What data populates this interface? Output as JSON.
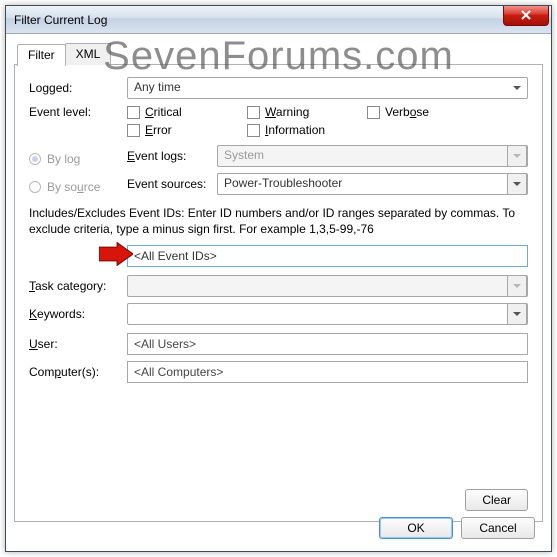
{
  "window": {
    "title": "Filter Current Log"
  },
  "watermark": "SevenForums.com",
  "tabs": {
    "filter": "Filter",
    "xml": "XML"
  },
  "labels": {
    "logged": "Logged:",
    "event_level": "Event level:",
    "by_log": "By log",
    "by_source": "By source",
    "event_logs": "Event logs:",
    "event_sources": "Event sources:",
    "task_category": "Task category:",
    "keywords": "Keywords:",
    "user": "User:",
    "computers": "Computer(s):"
  },
  "values": {
    "logged": "Any time",
    "event_logs": "System",
    "event_sources": "Power-Troubleshooter",
    "event_ids": "<All Event IDs>",
    "task_category": "",
    "keywords": "",
    "user": "<All Users>",
    "computers": "<All Computers>"
  },
  "checkboxes": {
    "critical": "Critical",
    "warning": "Warning",
    "verbose": "Verbose",
    "error": "Error",
    "information": "Information"
  },
  "help_text": "Includes/Excludes Event IDs: Enter ID numbers and/or ID ranges separated by commas. To exclude criteria, type a minus sign first. For example 1,3,5-99,-76",
  "buttons": {
    "clear": "Clear",
    "ok": "OK",
    "cancel": "Cancel"
  }
}
